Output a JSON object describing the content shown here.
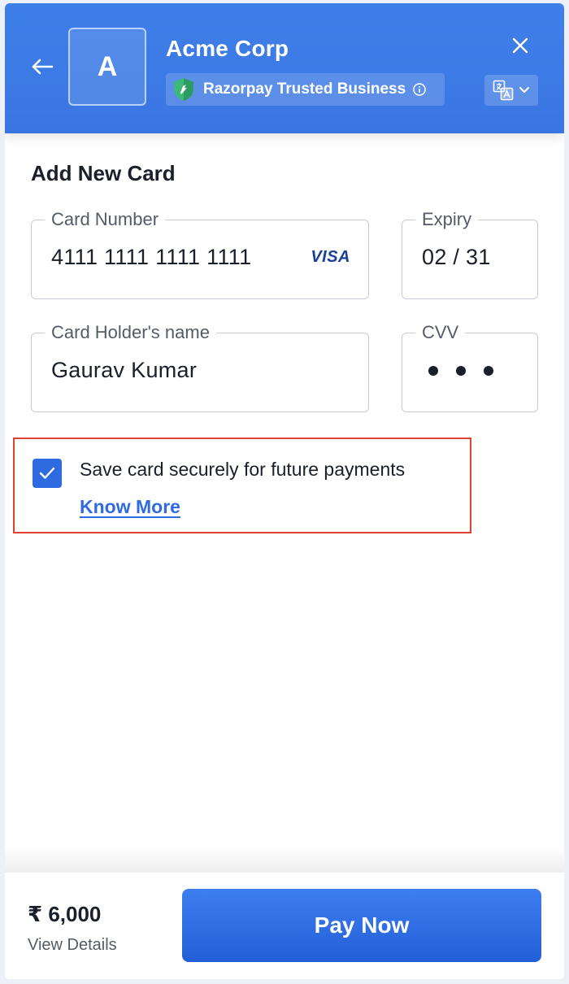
{
  "header": {
    "logo_letter": "A",
    "merchant_name": "Acme Corp",
    "trusted_label": "Razorpay Trusted Business"
  },
  "form": {
    "title": "Add New Card",
    "card_number": {
      "label": "Card Number",
      "value": "4111 1111 1111 1111",
      "network": "VISA"
    },
    "expiry": {
      "label": "Expiry",
      "value": "02 / 31"
    },
    "holder": {
      "label": "Card Holder's name",
      "value": "Gaurav Kumar"
    },
    "cvv": {
      "label": "CVV",
      "masked": "•••"
    },
    "save_card": {
      "checked": true,
      "label": "Save card securely for future payments",
      "link": "Know More"
    }
  },
  "footer": {
    "amount": "₹ 6,000",
    "view_details": "View Details",
    "pay_button": "Pay Now"
  },
  "colors": {
    "header_bg": "#3f7fe8",
    "accent": "#2f6be0",
    "highlight_border": "#e0432f"
  },
  "icons": [
    "back-arrow-icon",
    "close-icon",
    "shield-check-icon",
    "info-icon",
    "translate-icon",
    "chevron-down-icon",
    "checkmark-icon"
  ]
}
